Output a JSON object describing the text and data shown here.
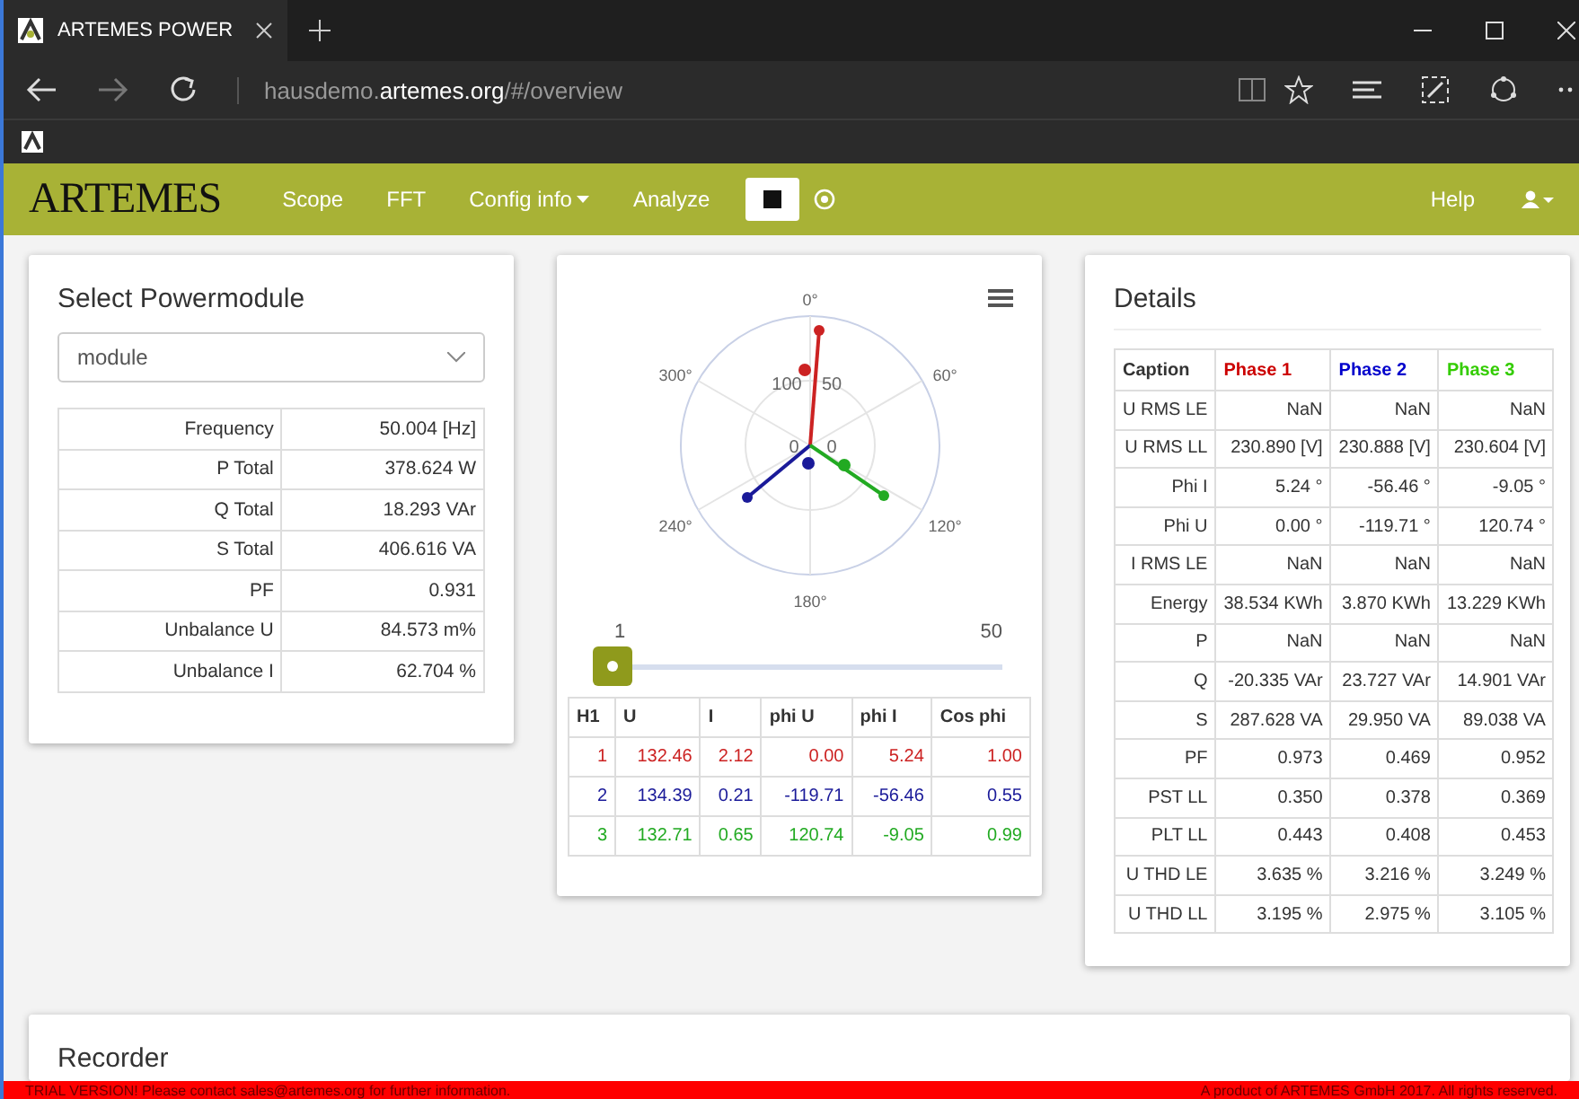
{
  "browser": {
    "tab_title": "ARTEMES POWER",
    "url": "hausdemo.**artemes.org**/#/overview"
  },
  "navbar": {
    "brand": "ARTEMES",
    "items": [
      {
        "label": "Scope",
        "kind": "link"
      },
      {
        "label": "FFT",
        "kind": "link"
      },
      {
        "label": "Config info",
        "kind": "dropdown"
      },
      {
        "label": "Analyze",
        "kind": "link"
      }
    ],
    "help": "Help"
  },
  "powermodule": {
    "title": "Select Powermodule",
    "select": "module",
    "rows": [
      {
        "label": "Frequency",
        "value": "50.004 [Hz]"
      },
      {
        "label": "P Total",
        "value": "378.624 W"
      },
      {
        "label": "Q Total",
        "value": "18.293 VAr"
      },
      {
        "label": "S Total",
        "value": "406.616 VA"
      },
      {
        "label": "PF",
        "value": "0.931"
      },
      {
        "label": "Unbalance U",
        "value": "84.573 m%"
      },
      {
        "label": "Unbalance I",
        "value": "62.704 %"
      }
    ]
  },
  "harmonics": {
    "angle_labels": [
      "0°",
      "60°",
      "120°",
      "180°",
      "240°",
      "300°"
    ],
    "radial_labels": [
      "100",
      "50",
      "0",
      "0"
    ],
    "slider": {
      "min_label": "1",
      "max_label": "50",
      "level": 0
    },
    "columns": [
      "H1",
      "U",
      "I",
      "phi U",
      "phi I",
      "Cos phi"
    ],
    "rows": [
      {
        "color": "#cc2222",
        "cells": [
          "1",
          "132.46",
          "2.12",
          "0.00",
          "5.24",
          "1.00"
        ]
      },
      {
        "color": "#1a1a99",
        "cells": [
          "2",
          "134.39",
          "0.21",
          "-119.71",
          "-56.46",
          "0.55"
        ]
      },
      {
        "color": "#22aa22",
        "cells": [
          "3",
          "132.71",
          "0.65",
          "120.74",
          "-9.05",
          "0.99"
        ]
      }
    ]
  },
  "details": {
    "title": "Details",
    "caption": "Caption",
    "phases": [
      {
        "label": "Phase 1",
        "color": "#cc0000"
      },
      {
        "label": "Phase 2",
        "color": "#0000cc"
      },
      {
        "label": "Phase 3",
        "color": "#33cc00"
      }
    ],
    "rows": [
      {
        "label": "U RMS LE",
        "values": [
          "NaN",
          "NaN",
          "NaN"
        ]
      },
      {
        "label": "U RMS LL",
        "values": [
          "230.890 [V]",
          "230.888 [V]",
          "230.604 [V]"
        ]
      },
      {
        "label": "Phi I",
        "values": [
          "5.24 °",
          "-56.46 °",
          "-9.05 °"
        ]
      },
      {
        "label": "Phi U",
        "values": [
          "0.00 °",
          "-119.71 °",
          "120.74 °"
        ]
      },
      {
        "label": "I RMS LE",
        "values": [
          "NaN",
          "NaN",
          "NaN"
        ]
      },
      {
        "label": "Energy",
        "values": [
          "38.534 KWh",
          "3.870 KWh",
          "13.229 KWh"
        ]
      },
      {
        "label": "P",
        "values": [
          "NaN",
          "NaN",
          "NaN"
        ]
      },
      {
        "label": "Q",
        "values": [
          "-20.335 VAr",
          "23.727 VAr",
          "14.901 VAr"
        ]
      },
      {
        "label": "S",
        "values": [
          "287.628 VA",
          "29.950 VA",
          "89.038 VA"
        ]
      },
      {
        "label": "PF",
        "values": [
          "0.973",
          "0.469",
          "0.952"
        ]
      },
      {
        "label": "PST LL",
        "values": [
          "0.350",
          "0.378",
          "0.369"
        ]
      },
      {
        "label": "PLT LL",
        "values": [
          "0.443",
          "0.408",
          "0.453"
        ]
      },
      {
        "label": "U THD LE",
        "values": [
          "3.635 %",
          "3.216 %",
          "3.249 %"
        ]
      },
      {
        "label": "U THD LL",
        "values": [
          "3.195 %",
          "2.975 %",
          "3.105 %"
        ]
      }
    ]
  },
  "recorder": {
    "title": "Recorder"
  },
  "footer": {
    "left": "TRIAL VERSION! Please contact sales@artemes.org for further information.",
    "right": "A product of ARTEMES GmbH 2017. All rights reserved."
  }
}
